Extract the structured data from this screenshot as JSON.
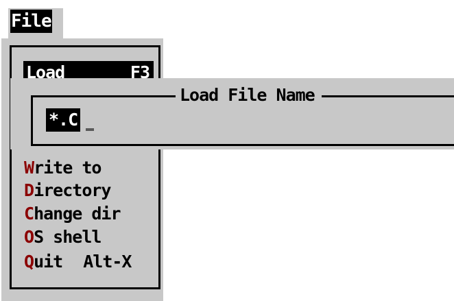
{
  "menubar": {
    "file_label": "File"
  },
  "file_menu": {
    "items": [
      {
        "label": "Load",
        "shortcut": "F3",
        "selected": true
      },
      {
        "hotkey": "W",
        "rest": "rite to"
      },
      {
        "hotkey": "D",
        "rest": "irectory"
      },
      {
        "hotkey": "C",
        "rest": "hange dir"
      },
      {
        "hotkey": "O",
        "rest": "S shell"
      },
      {
        "hotkey": "Q",
        "rest": "uit",
        "shortcut": "Alt-X"
      }
    ]
  },
  "load_dialog": {
    "title": "Load File Name",
    "input_value": "*.C"
  },
  "colors": {
    "panel_gray": "#c8c8c8",
    "hotkey_red": "#8b0000",
    "highlight": "#000000"
  }
}
